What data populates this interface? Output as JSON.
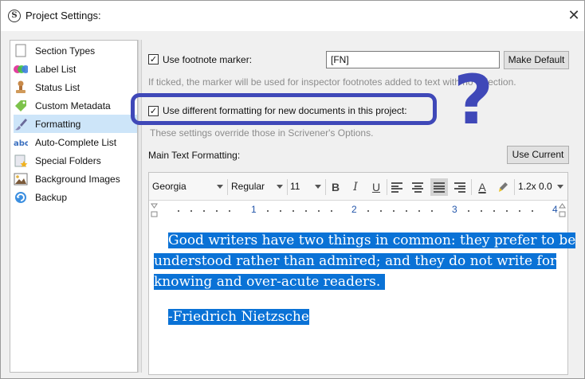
{
  "window": {
    "title": "Project Settings:",
    "close_glyph": "✕",
    "app_icon_glyph": "S"
  },
  "sidebar": {
    "items": [
      {
        "label": "Section Types",
        "icon": "section-types-icon"
      },
      {
        "label": "Label List",
        "icon": "label-list-icon"
      },
      {
        "label": "Status List",
        "icon": "status-stamp-icon"
      },
      {
        "label": "Custom Metadata",
        "icon": "tag-icon"
      },
      {
        "label": "Formatting",
        "icon": "brush-icon",
        "selected": true
      },
      {
        "label": "Auto-Complete List",
        "icon": "abc-icon"
      },
      {
        "label": "Special Folders",
        "icon": "folder-star-icon"
      },
      {
        "label": "Background Images",
        "icon": "image-icon"
      },
      {
        "label": "Backup",
        "icon": "backup-icon"
      }
    ]
  },
  "formatting": {
    "footnote_checkbox": {
      "label": "Use footnote marker:",
      "checked": true,
      "mark": "☑"
    },
    "footnote_value": "[FN]",
    "make_default_label": "Make Default",
    "footnote_hint": "If ticked, the marker will be used for inspector footnotes added to text with no selection.",
    "different_formatting_checkbox": {
      "label": "Use different formatting for new documents in this project:",
      "checked": true
    },
    "override_hint": "These settings override those in Scrivener's Options.",
    "main_text_label": "Main Text Formatting:",
    "use_current_label": "Use Current"
  },
  "editor_toolbar": {
    "font_family": "Georgia",
    "font_style": "Regular",
    "font_size": "11",
    "bold": "B",
    "italic": "I",
    "underline": "U",
    "text_color_glyph": "A",
    "line_spacing": "1.2x 0.0",
    "active_alignment": "justify"
  },
  "ruler": {
    "marks": [
      "1",
      "2",
      "3",
      "4"
    ]
  },
  "document": {
    "quote_lines": [
      "Good writers have two things in common: they prefer to be",
      "understood rather than admired; and they do not write for",
      "knowing and over-acute readers."
    ],
    "attribution": "-Friedrich Nietzsche"
  },
  "annotation": {
    "question_mark": "?",
    "color": "#3f48b8"
  },
  "colors": {
    "selection": "#0a72d6",
    "sidebar_selected": "#cde5f9"
  }
}
